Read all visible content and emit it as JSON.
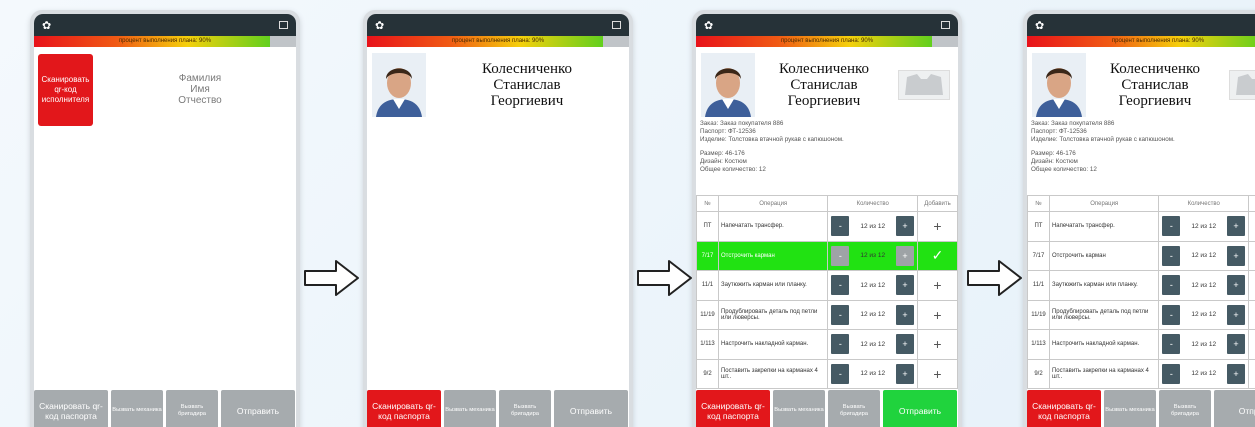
{
  "progress": {
    "label": "процент выполнения плана:",
    "value": "90%",
    "fraction": 0.9
  },
  "header": {
    "settings_icon": "gear-icon",
    "logout_icon": "logout-icon"
  },
  "screen1": {
    "scan_executor_btn": "Сканировать qr-код исполнителя",
    "surname": "Фамилия",
    "first_name": "Имя",
    "patronymic": "Отчество"
  },
  "worker": {
    "surname": "Колесниченко",
    "first_name": "Станислав",
    "patronymic": "Георгиевич"
  },
  "order": {
    "order_line": "Заказ: Заказ покупателя 886",
    "passport_line": "Паспорт:    ФТ-12536",
    "item_line": "Изделие: Толстовка втачной рукав с капюшоном.",
    "size_line": "Размер: 46-176",
    "design_line": "Дизайн: Костюм",
    "total_line": "Общее количество: 12"
  },
  "table": {
    "headers": {
      "num": "№",
      "op": "Операция",
      "qty": "Количество",
      "add": "Добавить"
    },
    "rows": [
      {
        "num": "ПТ",
        "op": "Напечатать трансфер.",
        "qty": "12 из 12",
        "add": "+"
      },
      {
        "num": "7/17",
        "op": "Отстрочить карман",
        "qty": "12 из 12",
        "add": "✓"
      },
      {
        "num": "11/1",
        "op": "Заутюжить карман или планку.",
        "qty": "12 из 12",
        "add": "+"
      },
      {
        "num": "11/19",
        "op": "Продублировать деталь под петли или люверсы.",
        "qty": "12 из 12",
        "add": "+"
      },
      {
        "num": "1/113",
        "op": "Настрочить накладной карман.",
        "qty": "12 из 12",
        "add": "+"
      },
      {
        "num": "9/2",
        "op": "Поставить закрепки на карманах 4 шт..",
        "qty": "12 из 12",
        "add": "+"
      }
    ],
    "minus": "-",
    "plus": "+"
  },
  "buttons": {
    "scan_passport": "Сканировать qr-код паспорта",
    "call_mechanic": "Вызвать механика",
    "call_foreman": "Вызвать бригадира",
    "send": "Отправить",
    "send_short": "Отпра"
  }
}
